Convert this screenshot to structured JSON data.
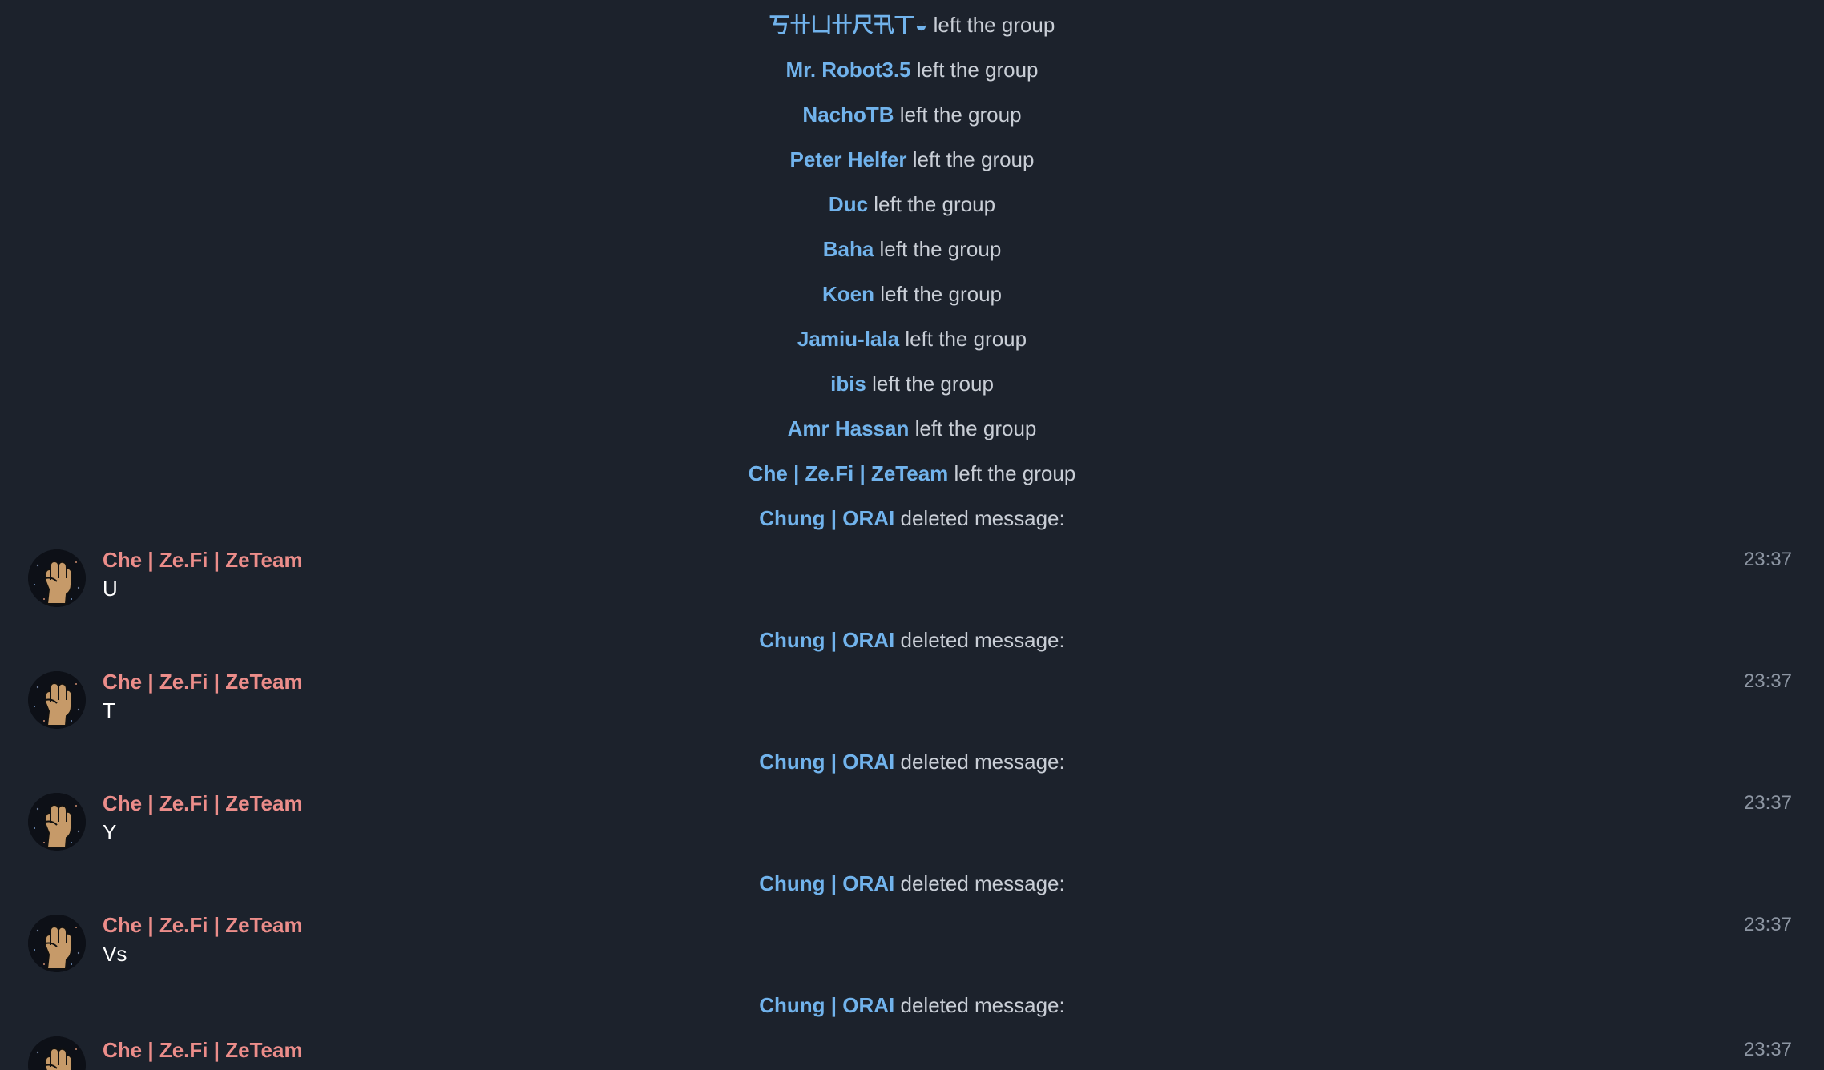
{
  "service_messages": [
    {
      "who": "丂卄凵卄尺卂丅◒",
      "what": "left the group"
    },
    {
      "who": "Mr. Robot3.5",
      "what": "left the group"
    },
    {
      "who": "NachoTB",
      "what": "left the group"
    },
    {
      "who": "Peter Helfer",
      "what": "left the group"
    },
    {
      "who": "Duc",
      "what": "left the group"
    },
    {
      "who": "Baha",
      "what": "left the group"
    },
    {
      "who": "Koen",
      "what": "left the group"
    },
    {
      "who": "Jamiu-lala",
      "what": "left the group"
    },
    {
      "who": "ibis",
      "what": "left the group"
    },
    {
      "who": "Amr Hassan",
      "what": "left the group"
    },
    {
      "who": "Che | Ze.Fi | ZeTeam",
      "what": "left the group"
    },
    {
      "who": "Chung | ORAI",
      "what": "deleted message:"
    }
  ],
  "deletion_notice": {
    "who": "Chung | ORAI",
    "what": "deleted message:"
  },
  "messages": [
    {
      "sender": "Che | Ze.Fi | ZeTeam",
      "text": "U",
      "time": "23:37",
      "avatar_icon": "raised-fist-icon"
    },
    {
      "sender": "Che | Ze.Fi | ZeTeam",
      "text": "T",
      "time": "23:37",
      "avatar_icon": "raised-fist-icon"
    },
    {
      "sender": "Che | Ze.Fi | ZeTeam",
      "text": "Y",
      "time": "23:37",
      "avatar_icon": "raised-fist-icon"
    },
    {
      "sender": "Che | Ze.Fi | ZeTeam",
      "text": "Vs",
      "time": "23:37",
      "avatar_icon": "raised-fist-icon"
    },
    {
      "sender": "Che | Ze.Fi | ZeTeam",
      "text": "",
      "time": "23:37",
      "avatar_icon": "raised-fist-icon"
    }
  ],
  "colors": {
    "background": "#1c222c",
    "service_name": "#71b3ec",
    "service_text": "#c9ced6",
    "sender_name": "#ec8d8a",
    "message_text": "#ffffff",
    "timestamp": "#8d96a3"
  }
}
